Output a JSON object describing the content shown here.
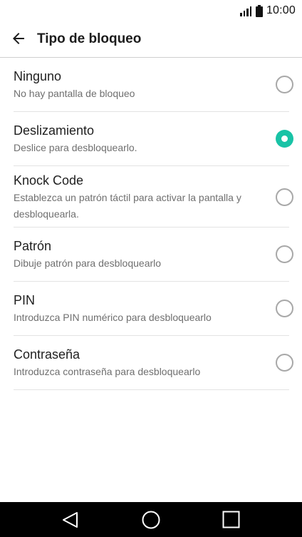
{
  "status_bar": {
    "time": "10:00",
    "icons": [
      "signal-icon",
      "battery-icon"
    ]
  },
  "header": {
    "title": "Tipo de bloqueo",
    "back_icon": "arrow-back-icon"
  },
  "lock_options": [
    {
      "title": "Ninguno",
      "subtitle": "No hay pantalla de bloqueo",
      "selected": false
    },
    {
      "title": "Deslizamiento",
      "subtitle": "Deslice para desbloquearlo.",
      "selected": true
    },
    {
      "title": "Knock Code",
      "subtitle": "Establezca un patrón táctil para activar la pantalla y desbloquearla.",
      "selected": false
    },
    {
      "title": "Patrón",
      "subtitle": "Dibuje patrón para desbloquearlo",
      "selected": false
    },
    {
      "title": "PIN",
      "subtitle": "Introduzca PIN numérico para desbloquearlo",
      "selected": false
    },
    {
      "title": "Contraseña",
      "subtitle": "Introduzca contraseña para desbloquearlo",
      "selected": false
    }
  ],
  "nav_bar": {
    "icons": [
      "back-triangle-icon",
      "home-circle-icon",
      "recents-square-icon"
    ]
  },
  "colors": {
    "accent": "#19c3a6",
    "nav_background": "#000000",
    "divider": "#e3e3e3"
  }
}
